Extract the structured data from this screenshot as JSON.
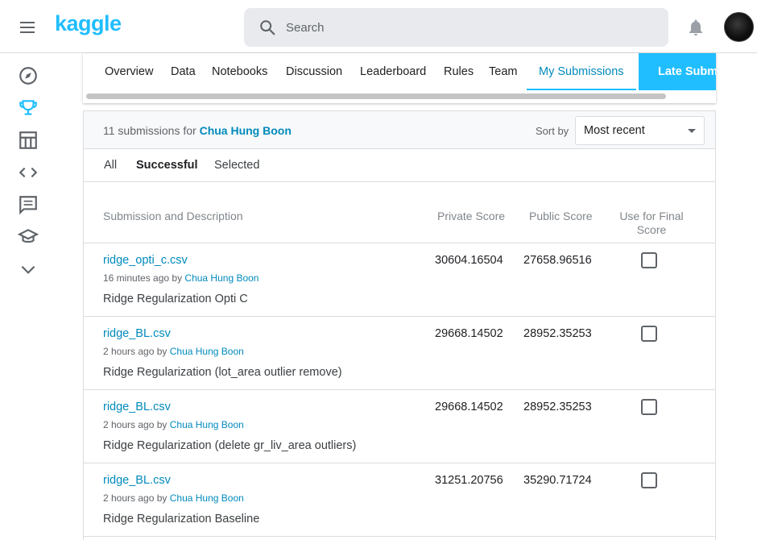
{
  "app": {
    "logo": "kaggle"
  },
  "search": {
    "placeholder": "Search"
  },
  "sidebar": {
    "items": [
      "compass-icon",
      "trophy-icon",
      "table-icon",
      "code-icon",
      "comment-icon",
      "school-icon",
      "chevron-down-icon"
    ],
    "active": "trophy-icon"
  },
  "tabs": [
    "Overview",
    "Data",
    "Notebooks",
    "Discussion",
    "Leaderboard",
    "Rules",
    "Team",
    "My Submissions",
    "Late Subm"
  ],
  "active_tab": "My Submissions",
  "submissions": {
    "count_prefix": "11 submissions for",
    "user": "Chua Hung Boon",
    "sort_label": "Sort by",
    "sort_value": "Most recent",
    "filters": [
      "All",
      "Successful",
      "Selected"
    ],
    "active_filter": "Successful",
    "columns": {
      "description": "Submission and Description",
      "private": "Private Score",
      "public": "Public Score",
      "final_1": "Use for Final",
      "final_2": "Score"
    },
    "rows": [
      {
        "file": "ridge_opti_c.csv",
        "time": "16 minutes ago by",
        "author": "Chua Hung Boon",
        "description": "Ridge Regularization Opti C",
        "private": "30604.16504",
        "public": "27658.96516",
        "selected": false
      },
      {
        "file": "ridge_BL.csv",
        "time": "2 hours ago by",
        "author": "Chua Hung Boon",
        "description": "Ridge Regularization (lot_area outlier remove)",
        "private": "29668.14502",
        "public": "28952.35253",
        "selected": false
      },
      {
        "file": "ridge_BL.csv",
        "time": "2 hours ago by",
        "author": "Chua Hung Boon",
        "description": "Ridge Regularization (delete gr_liv_area outliers)",
        "private": "29668.14502",
        "public": "28952.35253",
        "selected": false
      },
      {
        "file": "ridge_BL.csv",
        "time": "2 hours ago by",
        "author": "Chua Hung Boon",
        "description": "Ridge Regularization Baseline",
        "private": "31251.20756",
        "public": "35290.71724",
        "selected": false
      }
    ]
  },
  "colors": {
    "brand": "#20beff",
    "link": "#008abc"
  }
}
